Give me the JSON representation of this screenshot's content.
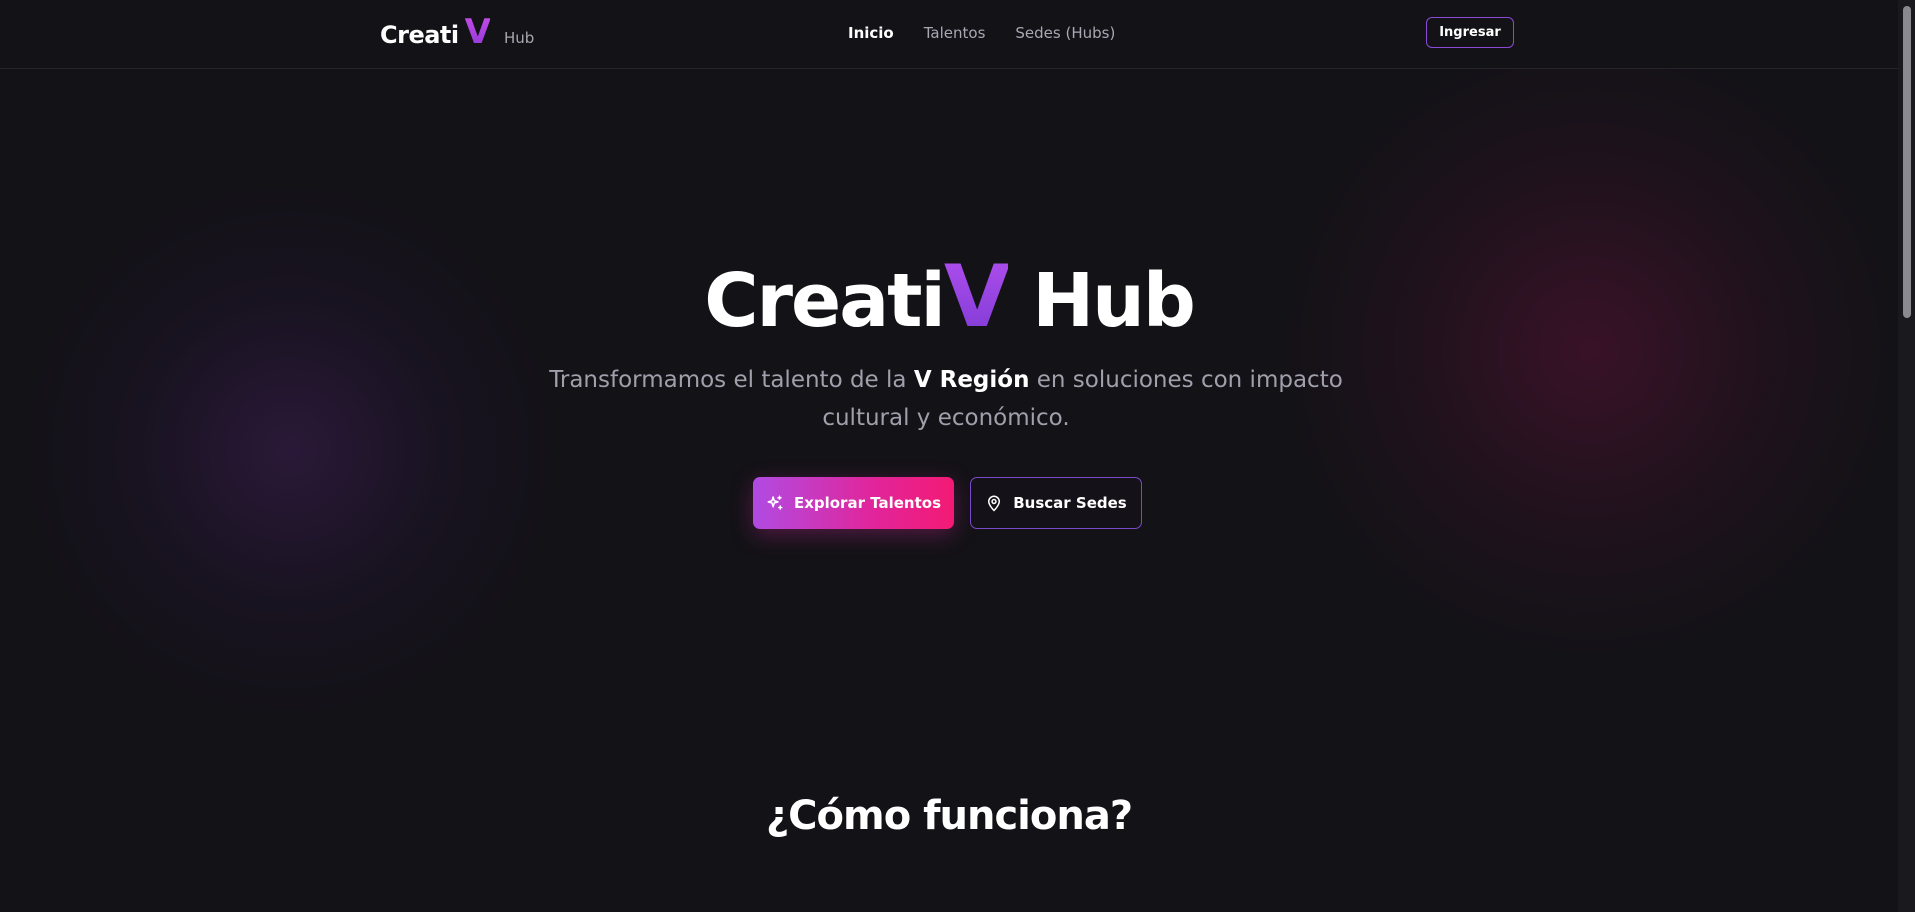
{
  "brand": {
    "name": "Creati",
    "v": "V",
    "sub": "Hub"
  },
  "nav": {
    "links": [
      {
        "label": "Inicio",
        "active": true
      },
      {
        "label": "Talentos",
        "active": false
      },
      {
        "label": "Sedes (Hubs)",
        "active": false
      }
    ],
    "login_label": "Ingresar"
  },
  "hero": {
    "title_pre": "Creati",
    "title_v": "V",
    "title_post": " Hub",
    "subtitle_pre": "Transformamos el talento de la ",
    "subtitle_bold": "V Región",
    "subtitle_post": " en soluciones con impacto cultural y económico.",
    "primary_cta": "Explorar Talentos",
    "primary_cta_icon": "sparkles-icon",
    "secondary_cta": "Buscar Sedes",
    "secondary_cta_icon": "map-pin-icon"
  },
  "section": {
    "title": "¿Cómo funciona?"
  },
  "colors": {
    "background": "#131217",
    "accent_purple": "#a24be6",
    "accent_pink": "#f31a74",
    "border_purple": "#8a4ad6"
  }
}
